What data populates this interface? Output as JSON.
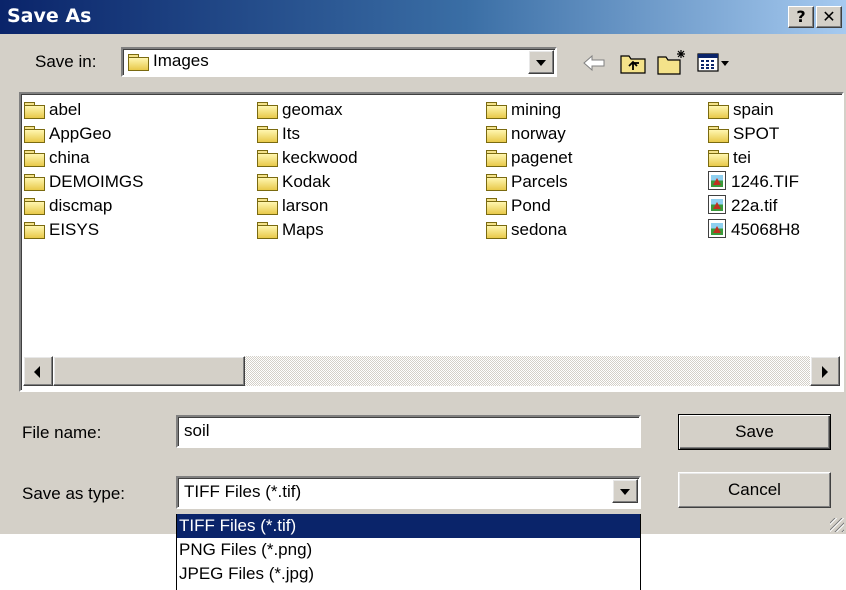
{
  "dialog": {
    "title": "Save As",
    "help_label": "?",
    "close_label": "✕"
  },
  "save_in": {
    "label": "Save in:",
    "value": "Images"
  },
  "toolbar": {
    "icons": [
      "back-arrow-icon",
      "up-folder-icon",
      "new-folder-icon",
      "view-menu-icon"
    ]
  },
  "file_list": {
    "items": [
      {
        "name": "abel",
        "type": "folder"
      },
      {
        "name": "AppGeo",
        "type": "folder"
      },
      {
        "name": "china",
        "type": "folder"
      },
      {
        "name": "DEMOIMGS",
        "type": "folder"
      },
      {
        "name": "discmap",
        "type": "folder"
      },
      {
        "name": "EISYS",
        "type": "folder"
      },
      {
        "name": "geomax",
        "type": "folder"
      },
      {
        "name": "Its",
        "type": "folder"
      },
      {
        "name": "keckwood",
        "type": "folder"
      },
      {
        "name": "Kodak",
        "type": "folder"
      },
      {
        "name": "larson",
        "type": "folder"
      },
      {
        "name": "Maps",
        "type": "folder"
      },
      {
        "name": "mining",
        "type": "folder"
      },
      {
        "name": "norway",
        "type": "folder"
      },
      {
        "name": "pagenet",
        "type": "folder"
      },
      {
        "name": "Parcels",
        "type": "folder"
      },
      {
        "name": "Pond",
        "type": "folder"
      },
      {
        "name": "sedona",
        "type": "folder"
      },
      {
        "name": "spain",
        "type": "folder"
      },
      {
        "name": "SPOT",
        "type": "folder"
      },
      {
        "name": "tei",
        "type": "folder"
      },
      {
        "name": "1246.TIF",
        "type": "image"
      },
      {
        "name": "22a.tif",
        "type": "image"
      },
      {
        "name": "45068H8",
        "type": "image"
      }
    ]
  },
  "file_name": {
    "label": "File name:",
    "value": "soil"
  },
  "save_as_type": {
    "label": "Save as type:",
    "value": "TIFF Files (*.tif)",
    "options": [
      "TIFF Files (*.tif)",
      "PNG Files (*.png)",
      "JPEG Files (*.jpg)"
    ]
  },
  "buttons": {
    "save": "Save",
    "cancel": "Cancel"
  },
  "colors": {
    "title_bar": "#0a246a",
    "dialog_face": "#d4d0c8",
    "selection": "#0a246a"
  }
}
